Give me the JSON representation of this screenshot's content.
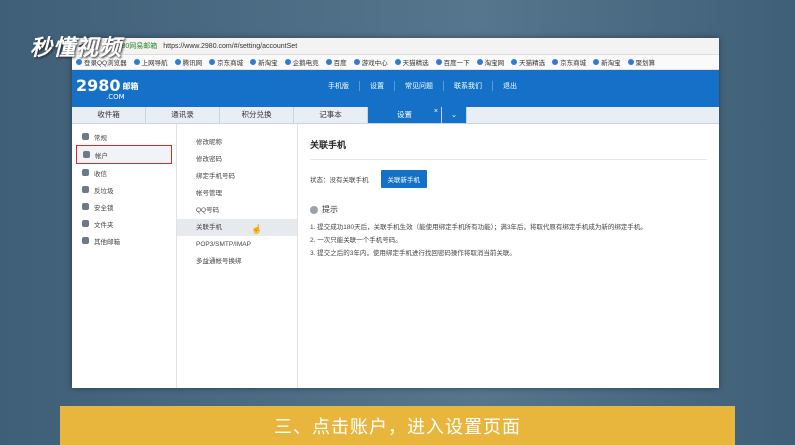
{
  "overlay": {
    "logo": "秒懂视频"
  },
  "browser": {
    "back_icon": "back-icon",
    "site_name": "2980网易邮箱",
    "url": "https://www.2980.com/#/setting/accountSet",
    "bookmarks": [
      "登录QQ浏览器",
      "上网导航",
      "腾讯网",
      "京东商城",
      "新淘宝",
      "企鹅电竞",
      "百度",
      "游戏中心",
      "天猫精选",
      "百度一下",
      "淘宝网",
      "天猫精选",
      "京东商城",
      "新淘宝",
      "聚划算"
    ]
  },
  "mail": {
    "logo": "2980",
    "logo_suffix": "邮箱",
    "logo_com": ".COM",
    "topnav": [
      "手机版",
      "设置",
      "常见问题",
      "联系我们",
      "退出"
    ],
    "tabs": [
      "收件箱",
      "通讯录",
      "积分兑换",
      "记事本",
      "设置"
    ],
    "active_tab": "设置"
  },
  "sidebar": {
    "items": [
      {
        "label": "常规"
      },
      {
        "label": "帐户"
      },
      {
        "label": "收信"
      },
      {
        "label": "反垃圾"
      },
      {
        "label": "安全锁"
      },
      {
        "label": "文件夹"
      },
      {
        "label": "其他邮箱"
      }
    ]
  },
  "subnav": {
    "items": [
      "修改昵称",
      "修改密码",
      "绑定手机号码",
      "帐号管理",
      "QQ号码",
      "关联手机",
      "POP3/SMTP/IMAP",
      "多益通帐号换绑"
    ]
  },
  "main": {
    "title": "关联手机",
    "status_label": "状态：没有关联手机",
    "bind_button": "关联新手机",
    "tips_title": "提示",
    "tips": [
      "1. 提交成功180天后，关联手机生效（能使用绑定手机所有功能）；满3年后，将取代原有绑定手机成为新的绑定手机。",
      "2. 一次只能关联一个手机号码。",
      "3. 提交之后的3年内，使用绑定手机进行找回密码操作将取消当前关联。"
    ]
  },
  "caption": "三、点击账户，进入设置页面"
}
